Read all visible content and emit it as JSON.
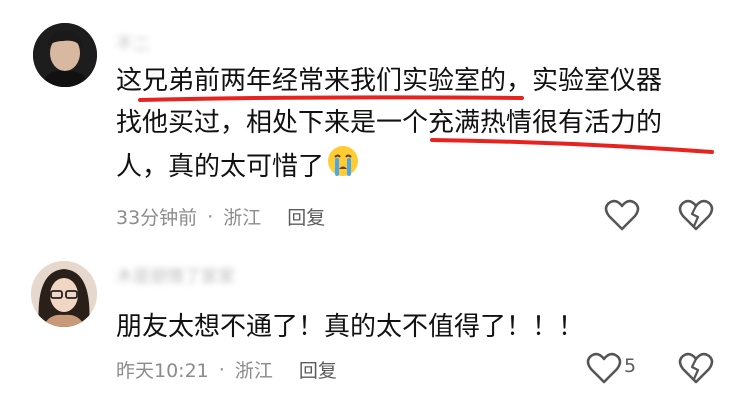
{
  "comments": [
    {
      "username": "不二",
      "lines": [
        "这兄弟前两年经常来我们实验室的，实验室仪器",
        "找他买过，相处下来是一个充满热情很有活力的",
        "人，真的太可惜了"
      ],
      "emoji": "crying-face-icon",
      "time": "33分钟前",
      "location": "浙江",
      "reply": "回复",
      "likes": ""
    },
    {
      "username": "木是朋情了家家",
      "lines": [
        "朋友太想不通了！真的太不值得了！！！"
      ],
      "time": "昨天10:21",
      "location": "浙江",
      "reply": "回复",
      "likes": "5"
    }
  ],
  "colors": {
    "underline": "#e8231f",
    "meta": "#8c8c8c"
  }
}
